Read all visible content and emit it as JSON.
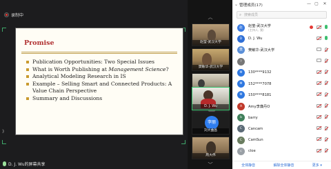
{
  "recording": {
    "label": "录制中"
  },
  "slide": {
    "title": "Promise",
    "bullets": [
      "Publication Opportunities: Two Special Issues",
      "What is Worth Publishing at ",
      "Analytical Modeling Research in IS",
      "Example – Selling Smart and Connected Products: A Value Chain Perspective",
      "Summary and Discussions"
    ],
    "bullet_2_italic": "Management Science",
    "bullet_2_tail": "?"
  },
  "presenter": {
    "label": "D. J. Wu的屏幕共享"
  },
  "videos": [
    {
      "name": "赵莹-武汉大学"
    },
    {
      "name": "樊敏华-武汉大学"
    },
    {
      "name": ""
    },
    {
      "name": "苟冶"
    },
    {
      "name": "D. J. Wu"
    },
    {
      "name": "刘大曲昌"
    },
    {
      "name": "周大伟"
    }
  ],
  "video_initial": "李丽",
  "panel": {
    "title": "管理成员(17)",
    "search_placeholder": "搜索成员",
    "members": [
      {
        "name": "赵莹-武汉大学",
        "sub": "(主持人, 我)",
        "avatar": "赵",
        "color": "#3b7be0",
        "icons": [
          "rec",
          "cam-off",
          "mic-on"
        ]
      },
      {
        "name": "D. J. Wu",
        "sub": "",
        "avatar": "D",
        "color": "#2f6fd6",
        "icons": [
          "cam-off",
          "mic-on"
        ]
      },
      {
        "name": "樊敏华-武汉大学",
        "sub": "",
        "avatar": "樊",
        "color": "#5a8fd8",
        "icons": [
          "cam",
          "mic-off"
        ]
      },
      {
        "name": "",
        "sub": "",
        "avatar": "?",
        "color": "#777777",
        "icons": [
          "cam",
          "mic-off"
        ]
      },
      {
        "name": "130****9132",
        "sub": "",
        "avatar": "M",
        "color": "#2f78e0",
        "icons": [
          "cam-off",
          "mic-off"
        ]
      },
      {
        "name": "152****7078",
        "sub": "",
        "avatar": "M",
        "color": "#2f78e0",
        "icons": [
          "cam-off",
          "mic-off"
        ]
      },
      {
        "name": "150****8181",
        "sub": "",
        "avatar": "M",
        "color": "#2f78e0",
        "icons": [
          "cam-off",
          "mic-off"
        ]
      },
      {
        "name": "Amy李廉丹O",
        "sub": "",
        "avatar": "A",
        "color": "#c0392b",
        "icons": [
          "cam-off",
          "mic-off"
        ]
      },
      {
        "name": "barry",
        "sub": "",
        "avatar": "b",
        "color": "#3f7f5a",
        "icons": [
          "cam-off",
          "mic-off"
        ]
      },
      {
        "name": "Cancam",
        "sub": "",
        "avatar": "C",
        "color": "#5c6b77",
        "icons": [
          "cam-off",
          "mic-off"
        ]
      },
      {
        "name": "CamSun",
        "sub": "",
        "avatar": "C",
        "color": "#6a7d60",
        "icons": [
          "cam-off",
          "mic-off"
        ]
      },
      {
        "name": "cloe",
        "sub": "",
        "avatar": "c",
        "color": "#9aa0a6",
        "icons": [
          "cam-off",
          "mic-off"
        ]
      }
    ],
    "footer": [
      "全体静音",
      "解除全体静音",
      "更多 ▾"
    ]
  }
}
